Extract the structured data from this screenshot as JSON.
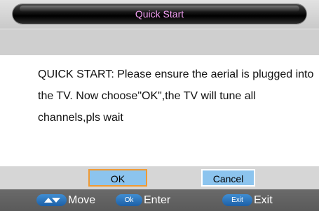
{
  "dialog": {
    "title": "Quick Start",
    "message": "QUICK START: Please ensure the aerial  is plugged into the TV. Now  choose\"OK\",the TV will tune all channels,pls wait"
  },
  "buttons": {
    "ok_label": "OK",
    "cancel_label": "Cancel",
    "focused": "OK"
  },
  "hints": [
    {
      "key_icon": "up-down-arrows-icon",
      "key_text": "",
      "label": "Move"
    },
    {
      "key_icon": "ok-key-icon",
      "key_text": "Ok",
      "label": "Enter"
    },
    {
      "key_icon": "exit-key-icon",
      "key_text": "Exit",
      "label": "Exit"
    }
  ],
  "colors": {
    "title_text": "#f4a0f4",
    "button_fill": "#8cc4ee",
    "focus_border": "#f09a33",
    "key_badge": "#2b75bf",
    "footer_bg": "#606060"
  }
}
